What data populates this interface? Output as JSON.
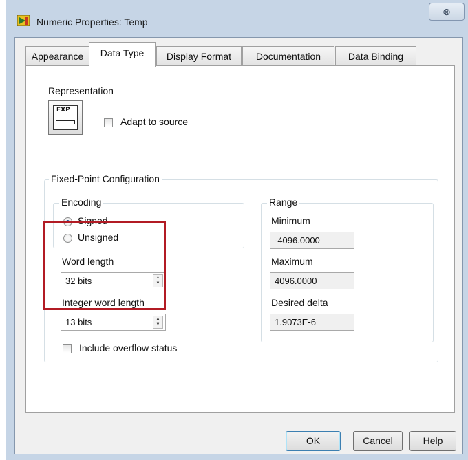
{
  "window": {
    "title": "Numeric Properties: Temp",
    "close_glyph": "⊗"
  },
  "tabs": [
    {
      "label": "Appearance",
      "active": false
    },
    {
      "label": "Data Type",
      "active": true
    },
    {
      "label": "Display Format",
      "active": false
    },
    {
      "label": "Documentation",
      "active": false
    },
    {
      "label": "Data Binding",
      "active": false
    }
  ],
  "representation": {
    "label": "Representation",
    "icon_text": "FXP",
    "adapt_to_source_label": "Adapt to source",
    "adapt_to_source_checked": false
  },
  "fixed_point": {
    "group_label": "Fixed-Point Configuration",
    "encoding": {
      "label": "Encoding",
      "options": [
        {
          "label": "Signed",
          "selected": true
        },
        {
          "label": "Unsigned",
          "selected": false
        }
      ]
    },
    "word_length": {
      "label": "Word length",
      "value": "32 bits"
    },
    "integer_word_length": {
      "label": "Integer word length",
      "value": "13 bits"
    },
    "range": {
      "label": "Range",
      "minimum": {
        "label": "Minimum",
        "value": "-4096.0000"
      },
      "maximum": {
        "label": "Maximum",
        "value": "4096.0000"
      },
      "desired_delta": {
        "label": "Desired delta",
        "value": "1.9073E-6"
      }
    },
    "include_overflow_status": {
      "label": "Include overflow status",
      "checked": false
    }
  },
  "buttons": {
    "ok": "OK",
    "cancel": "Cancel",
    "help": "Help"
  },
  "colors": {
    "highlight_box": "#b21b24",
    "window_frame": "#c6d5e6",
    "radio_selected": "#1b4f93"
  }
}
